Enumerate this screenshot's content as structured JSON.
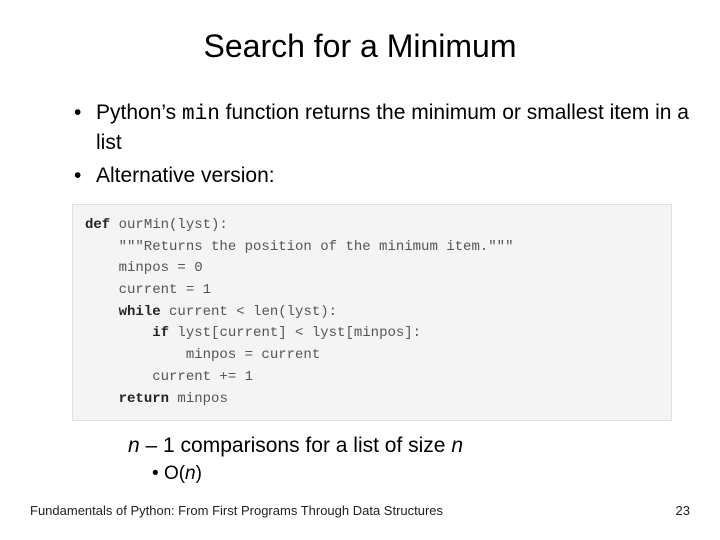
{
  "title": "Search for a Minimum",
  "bullets": {
    "b1_pre": "Python’s ",
    "b1_code": "min",
    "b1_post": " function returns the minimum or smallest item in a list",
    "b2": "Alternative version:"
  },
  "code": {
    "l1a": "def",
    "l1b": " ourMin(lyst):",
    "l2": "    \"\"\"Returns the position of the minimum item.\"\"\"",
    "l3": "    minpos = 0",
    "l4": "    current = 1",
    "l5a": "    ",
    "l5b": "while",
    "l5c": " current < len(lyst):",
    "l6a": "        ",
    "l6b": "if",
    "l6c": " lyst[current] < lyst[minpos]:",
    "l7": "            minpos = current",
    "l8": "        current += 1",
    "l9a": "    ",
    "l9b": "return",
    "l9c": " minpos"
  },
  "summary": {
    "line_prefix_n": "n",
    "line_mid": " – 1 comparisons for a list of size ",
    "line_suffix_n": "n",
    "bigO_pre": "O(",
    "bigO_n": "n",
    "bigO_post": ")"
  },
  "footer": "Fundamentals of Python: From First Programs Through Data Structures",
  "pagenum": "23"
}
